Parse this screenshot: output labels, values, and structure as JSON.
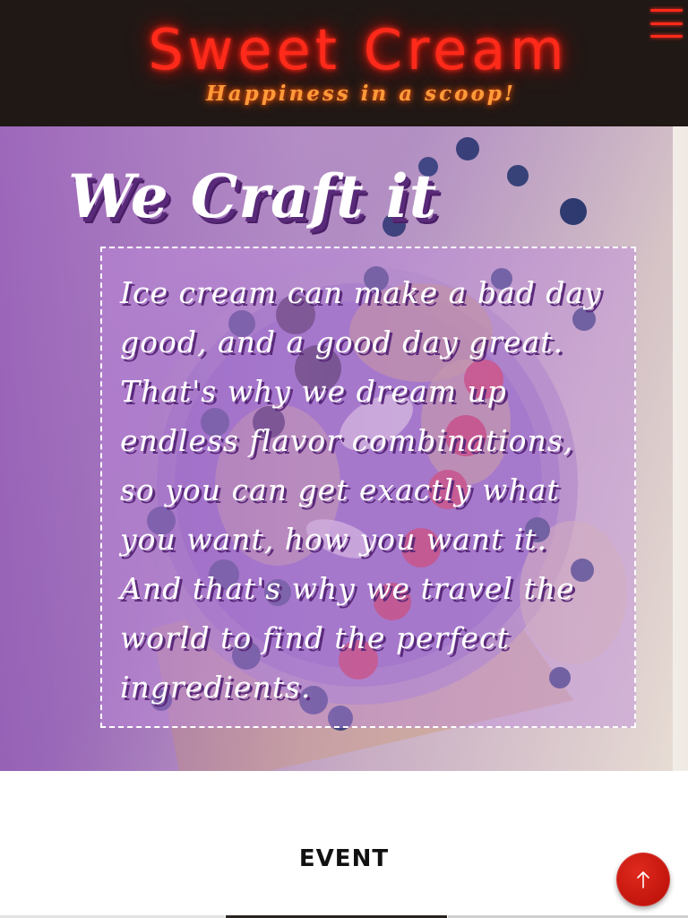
{
  "header": {
    "brand_title": "Sweet Cream",
    "tagline": "Happiness in a scoop!",
    "menu_icon": "hamburger-menu-icon",
    "accent_color": "#ff2a1a",
    "tagline_color": "#ff9a3a",
    "background": "#201815"
  },
  "hero": {
    "heading": "We Craft it",
    "body": "Ice cream can make a bad day good, and a good day great. That's why we dream up endless flavor combinations, so you can get exactly what you want, how you want it. And that's why we travel the world to find the perfect ingredients."
  },
  "event": {
    "title": "EVENT"
  },
  "scroll_top": {
    "icon": "arrow-up-icon",
    "color": "#d11a10"
  }
}
